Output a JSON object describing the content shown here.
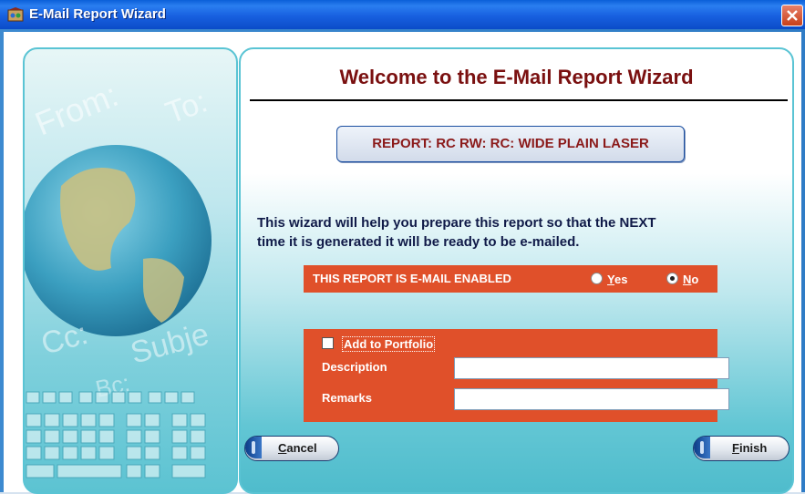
{
  "window": {
    "title": "E-Mail Report Wizard"
  },
  "heading": "Welcome to the E-Mail Report Wizard",
  "report": {
    "label": "REPORT: RC RW: RC: WIDE PLAIN LASER"
  },
  "info": {
    "line1": "This wizard will help you prepare this report so that the NEXT",
    "line2": "time it is generated it will be ready to be e-mailed."
  },
  "email_enabled": {
    "label": "THIS REPORT IS E-MAIL ENABLED",
    "yes_accel": "Y",
    "yes_rest": "es",
    "no_accel": "N",
    "no_rest": "o",
    "selected": "No"
  },
  "portfolio": {
    "checkbox_label": "Add to Portfolio",
    "checked": false,
    "description_label": "Description",
    "description_value": "",
    "remarks_label": "Remarks",
    "remarks_value": ""
  },
  "sidebar_art": {
    "from": "From:",
    "to": "To:",
    "cc": "Cc:",
    "subject": "Subje",
    "bc": "Bc:"
  },
  "buttons": {
    "cancel_accel": "C",
    "cancel_rest": "ancel",
    "finish_accel": "F",
    "finish_rest": "inish"
  },
  "colors": {
    "titlebar": "#0b5ed9",
    "accent_orange": "#e0502a",
    "heading_red": "#7a1010",
    "panel_teal": "#5ac4d4"
  }
}
